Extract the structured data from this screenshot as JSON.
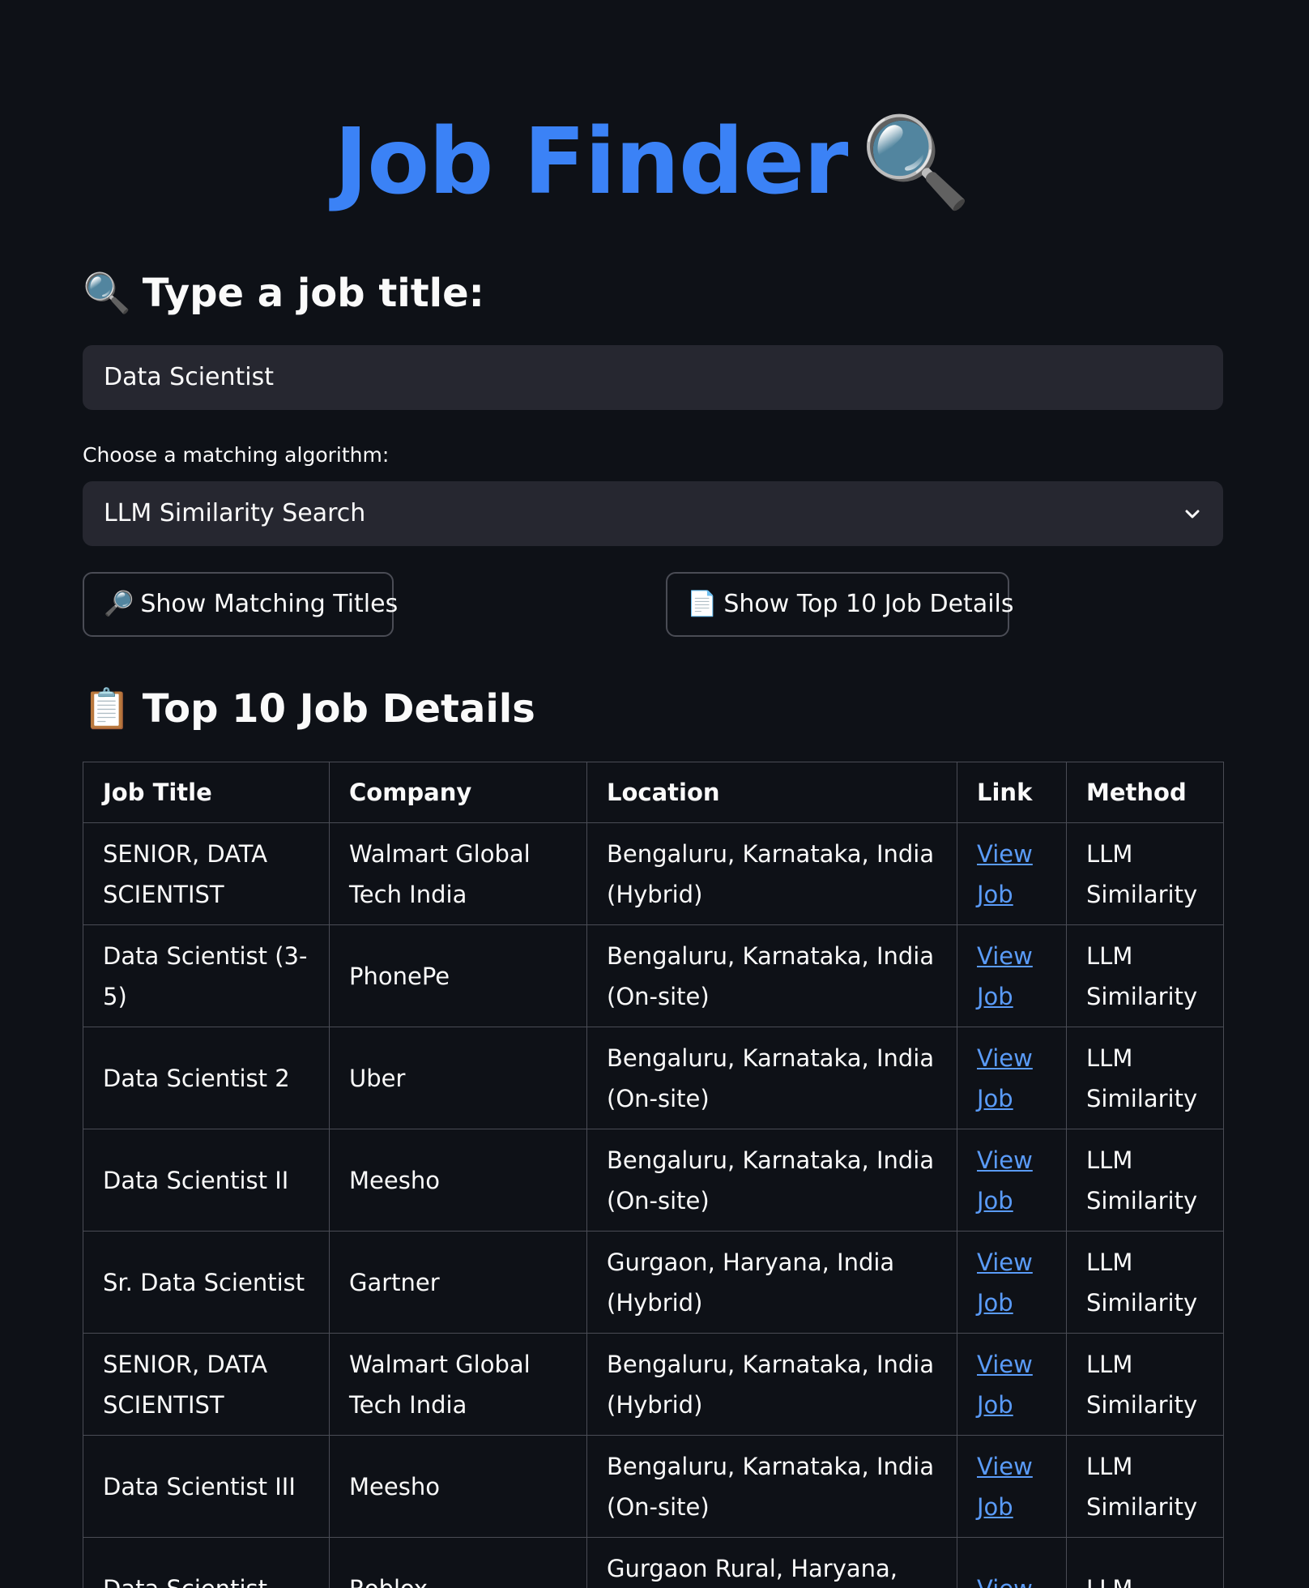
{
  "header": {
    "title": "Job Finder",
    "title_emoji": "🔍"
  },
  "search": {
    "heading": "Type a job title:",
    "heading_emoji": "🔍",
    "value": "Data Scientist"
  },
  "algorithm": {
    "label": "Choose a matching algorithm:",
    "selected": "LLM Similarity Search"
  },
  "buttons": {
    "show_titles": "Show Matching Titles",
    "show_titles_emoji": "🔎",
    "show_details": "Show Top 10 Job Details",
    "show_details_emoji": "📄"
  },
  "results": {
    "heading": "Top 10 Job Details",
    "heading_emoji": "📋",
    "columns": [
      "Job Title",
      "Company",
      "Location",
      "Link",
      "Method"
    ],
    "rows": [
      {
        "title": "SENIOR, DATA SCIENTIST",
        "company": "Walmart Global Tech India",
        "location": "Bengaluru, Karnataka, India (Hybrid)",
        "link": "View Job",
        "method": "LLM Similarity"
      },
      {
        "title": "Data Scientist (3-5)",
        "company": "PhonePe",
        "location": "Bengaluru, Karnataka, India (On-site)",
        "link": "View Job",
        "method": "LLM Similarity"
      },
      {
        "title": "Data Scientist 2",
        "company": "Uber",
        "location": "Bengaluru, Karnataka, India (On-site)",
        "link": "View Job",
        "method": "LLM Similarity"
      },
      {
        "title": "Data Scientist II",
        "company": "Meesho",
        "location": "Bengaluru, Karnataka, India (On-site)",
        "link": "View Job",
        "method": "LLM Similarity"
      },
      {
        "title": "Sr. Data Scientist",
        "company": "Gartner",
        "location": "Gurgaon, Haryana, India (Hybrid)",
        "link": "View Job",
        "method": "LLM Similarity"
      },
      {
        "title": "SENIOR, DATA SCIENTIST",
        "company": "Walmart Global Tech India",
        "location": "Bengaluru, Karnataka, India (Hybrid)",
        "link": "View Job",
        "method": "LLM Similarity"
      },
      {
        "title": "Data Scientist III",
        "company": "Meesho",
        "location": "Bengaluru, Karnataka, India (On-site)",
        "link": "View Job",
        "method": "LLM Similarity"
      },
      {
        "title": "Data Scientist",
        "company": "Roblox",
        "location": "Gurgaon Rural, Haryana, India",
        "link": "View",
        "method": "LLM"
      }
    ]
  }
}
